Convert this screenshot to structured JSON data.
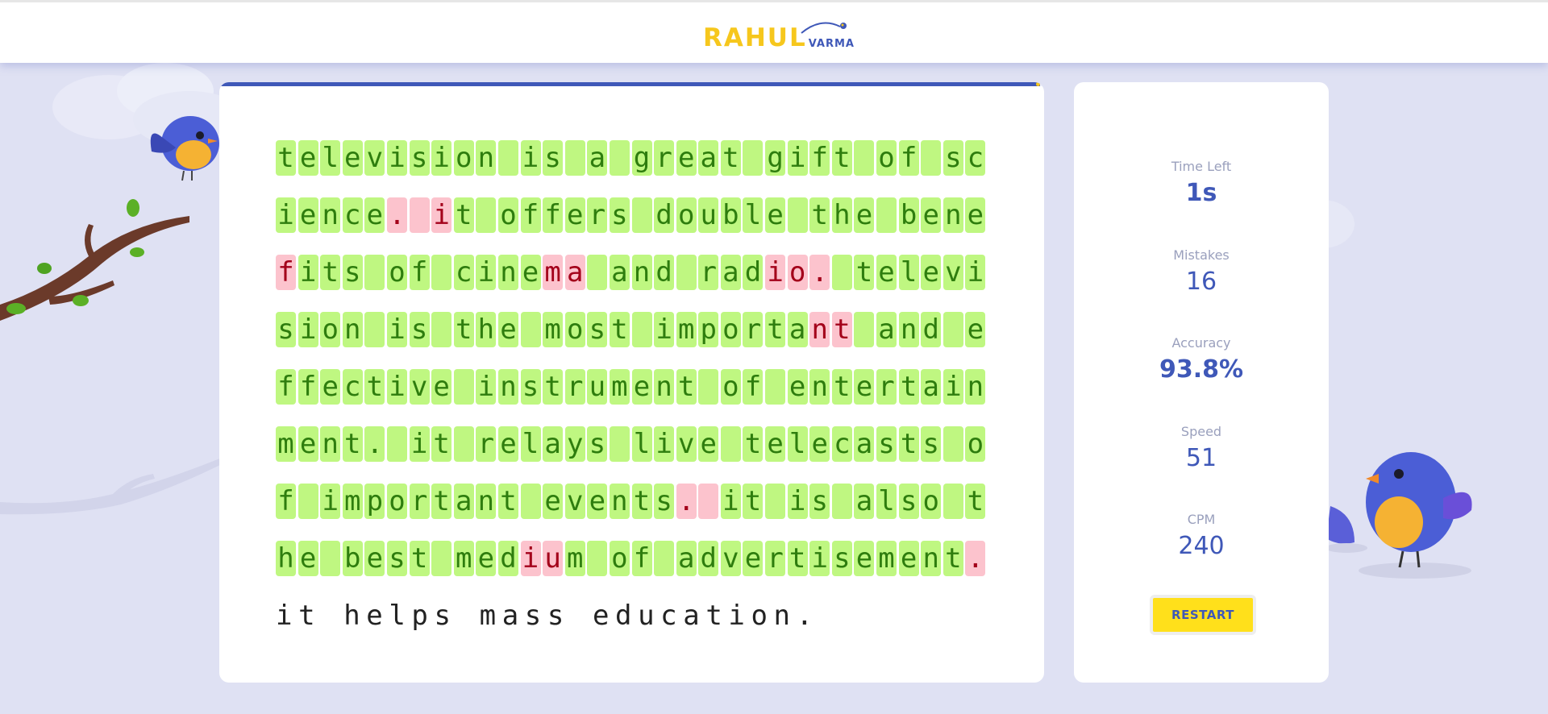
{
  "header": {
    "logo_main": "RAHUL",
    "logo_sub": "VARMA"
  },
  "progress": {
    "fraction": 0.995
  },
  "typing": {
    "lines": [
      {
        "text": "television is a great gift of sc",
        "errors": []
      },
      {
        "text": "ience. it offers double the bene",
        "errors": [
          5,
          6,
          7
        ]
      },
      {
        "text": "fits of cinema and radio. televi",
        "errors": [
          0,
          12,
          13,
          22,
          23,
          24
        ]
      },
      {
        "text": "sion is the most important and e",
        "errors": [
          24,
          25
        ]
      },
      {
        "text": "ffective instrument of entertain",
        "errors": []
      },
      {
        "text": "ment. it relays live telecasts o",
        "errors": []
      },
      {
        "text": "f important events. it is also t",
        "errors": [
          18,
          19
        ]
      },
      {
        "text": "he best medium of advertisement.",
        "errors": [
          11,
          12,
          31
        ]
      },
      {
        "text": "it helps mass education.",
        "pending": true
      }
    ]
  },
  "stats": {
    "time_left_label": "Time Left",
    "time_left_value": "1s",
    "mistakes_label": "Mistakes",
    "mistakes_value": "16",
    "accuracy_label": "Accuracy",
    "accuracy_value": "93.8%",
    "speed_label": "Speed",
    "speed_value": "51",
    "cpm_label": "CPM",
    "cpm_value": "240",
    "restart_label": "RESTART"
  },
  "colors": {
    "accent": "#3f58b8",
    "brand_yellow": "#f6c71d",
    "correct_bg": "#bff781",
    "error_bg": "#fcc3cd"
  }
}
